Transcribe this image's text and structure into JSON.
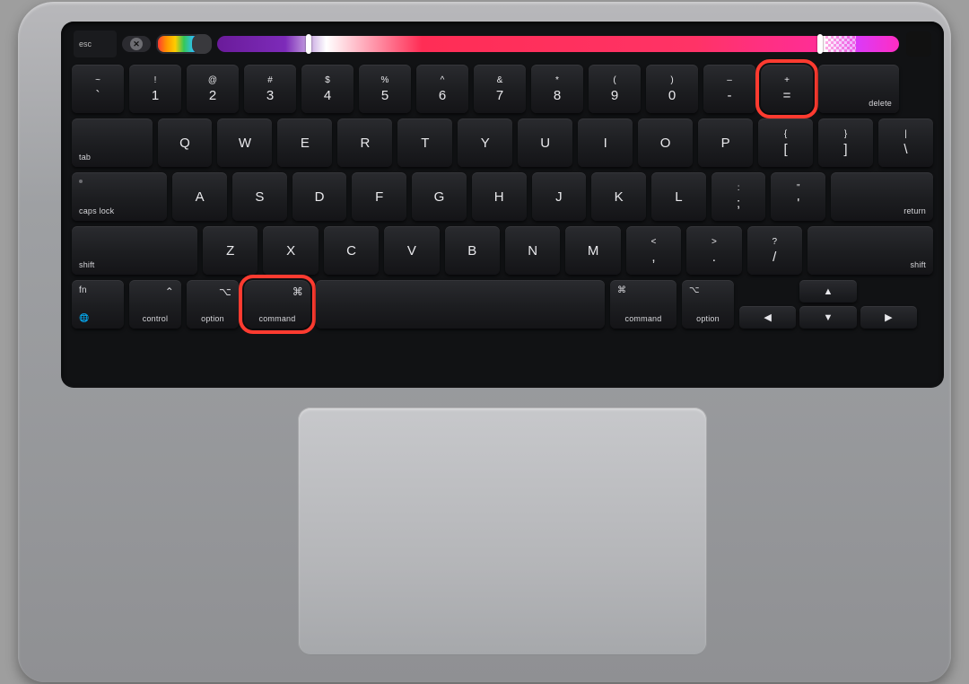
{
  "touchbar": {
    "esc": "esc"
  },
  "row_num": {
    "tilde": {
      "up": "~",
      "main": "`"
    },
    "n1": {
      "up": "!",
      "main": "1"
    },
    "n2": {
      "up": "@",
      "main": "2"
    },
    "n3": {
      "up": "#",
      "main": "3"
    },
    "n4": {
      "up": "$",
      "main": "4"
    },
    "n5": {
      "up": "%",
      "main": "5"
    },
    "n6": {
      "up": "^",
      "main": "6"
    },
    "n7": {
      "up": "&",
      "main": "7"
    },
    "n8": {
      "up": "*",
      "main": "8"
    },
    "n9": {
      "up": "(",
      "main": "9"
    },
    "n0": {
      "up": ")",
      "main": "0"
    },
    "minus": {
      "up": "–",
      "main": "-"
    },
    "equals": {
      "up": "+",
      "main": "="
    },
    "delete": "delete"
  },
  "row_q": {
    "tab": "tab",
    "q": "Q",
    "w": "W",
    "e": "E",
    "r": "R",
    "t": "T",
    "y": "Y",
    "u": "U",
    "i": "I",
    "o": "O",
    "p": "P",
    "lbr": {
      "up": "{",
      "main": "["
    },
    "rbr": {
      "up": "}",
      "main": "]"
    },
    "bslash": {
      "up": "|",
      "main": "\\"
    }
  },
  "row_a": {
    "caps": "caps lock",
    "a": "A",
    "s": "S",
    "d": "D",
    "f": "F",
    "g": "G",
    "h": "H",
    "j": "J",
    "k": "K",
    "l": "L",
    "semi": {
      "up": ":",
      "main": ";"
    },
    "quote": {
      "up": "\"",
      "main": "'"
    },
    "ret": "return"
  },
  "row_z": {
    "shift": "shift",
    "z": "Z",
    "x": "X",
    "c": "C",
    "v": "V",
    "b": "B",
    "n": "N",
    "m": "M",
    "comma": {
      "up": "<",
      "main": ","
    },
    "period": {
      "up": ">",
      "main": "."
    },
    "slash": {
      "up": "?",
      "main": "/"
    },
    "shift_r": "shift"
  },
  "row_mod": {
    "fn_top": "fn",
    "fn_icon": "🌐",
    "control_sym": "⌃",
    "control": "control",
    "option_sym": "⌥",
    "option": "option",
    "command_sym": "⌘",
    "command": "command",
    "command_r": "command",
    "option_r": "option",
    "arrows": {
      "up": "▲",
      "down": "▼",
      "left": "◀",
      "right": "▶"
    }
  },
  "highlighted_keys": [
    "equals-key",
    "command-left-key"
  ],
  "colors": {
    "highlight": "#ff3b30",
    "chassis": "#a1a2a5",
    "keycap": "#1d1e21"
  }
}
